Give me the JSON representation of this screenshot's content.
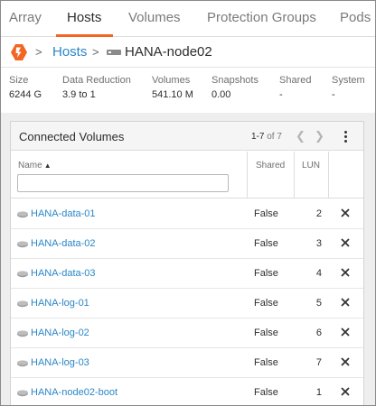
{
  "tabs": [
    {
      "label": "Array",
      "active": false
    },
    {
      "label": "Hosts",
      "active": true
    },
    {
      "label": "Volumes",
      "active": false
    },
    {
      "label": "Protection Groups",
      "active": false
    },
    {
      "label": "Pods",
      "active": false
    }
  ],
  "accent_color": "#f26522",
  "link_color": "#2a86c8",
  "breadcrumb": {
    "logo_icon": "pure-storage-logo-icon",
    "separator": ">",
    "parent": "Hosts",
    "host_icon": "host-icon",
    "current": "HANA-node02"
  },
  "stats": [
    {
      "label": "Size",
      "value": "6244 G"
    },
    {
      "label": "Data Reduction",
      "value": "3.9 to 1"
    },
    {
      "label": "Volumes",
      "value": "541.10 M"
    },
    {
      "label": "Snapshots",
      "value": "0.00"
    },
    {
      "label": "Shared",
      "value": "-"
    },
    {
      "label": "System",
      "value": "-"
    }
  ],
  "connected_volumes": {
    "title": "Connected Volumes",
    "pager": {
      "range": "1-7",
      "of_label": "of 7"
    },
    "columns": {
      "name": "Name",
      "shared": "Shared",
      "lun": "LUN"
    },
    "sort_indicator": "▲",
    "filter": {
      "value": "",
      "placeholder": ""
    },
    "rows": [
      {
        "name": "HANA-data-01",
        "shared": "False",
        "lun": "2"
      },
      {
        "name": "HANA-data-02",
        "shared": "False",
        "lun": "3"
      },
      {
        "name": "HANA-data-03",
        "shared": "False",
        "lun": "4"
      },
      {
        "name": "HANA-log-01",
        "shared": "False",
        "lun": "5"
      },
      {
        "name": "HANA-log-02",
        "shared": "False",
        "lun": "6"
      },
      {
        "name": "HANA-log-03",
        "shared": "False",
        "lun": "7"
      },
      {
        "name": "HANA-node02-boot",
        "shared": "False",
        "lun": "1"
      }
    ]
  }
}
